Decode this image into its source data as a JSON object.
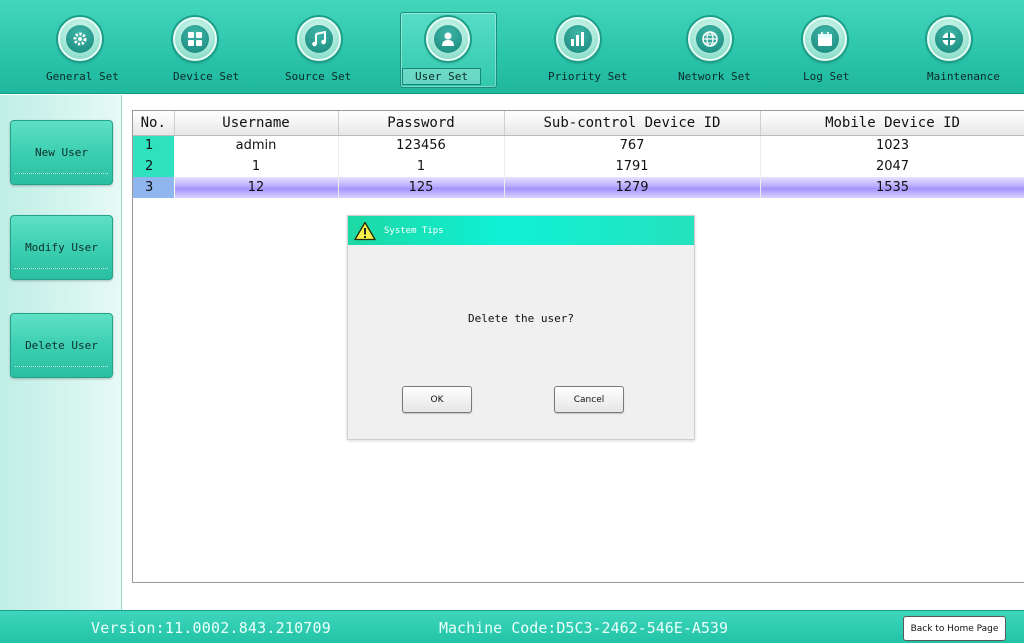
{
  "toolbar": {
    "items": [
      {
        "label": "General Set",
        "icon": "gear-icon"
      },
      {
        "label": "Device Set",
        "icon": "grid-icon"
      },
      {
        "label": "Source Set",
        "icon": "music-note-icon"
      },
      {
        "label": "User Set",
        "icon": "user-icon",
        "active": true
      },
      {
        "label": "Priority Set",
        "icon": "bar-chart-icon"
      },
      {
        "label": "Network Set",
        "icon": "globe-icon"
      },
      {
        "label": "Log Set",
        "icon": "calendar-icon"
      },
      {
        "label": "Maintenance",
        "icon": "shield-icon"
      }
    ]
  },
  "sidebar": {
    "new_user": "New User",
    "modify_user": "Modify User",
    "delete_user": "Delete User"
  },
  "table": {
    "columns": [
      "No.",
      "Username",
      "Password",
      "Sub-control Device ID",
      "Mobile Device ID"
    ],
    "rows": [
      {
        "no": "1",
        "username": "admin",
        "password": "123456",
        "sub_id": "767",
        "mobile_id": "1023"
      },
      {
        "no": "2",
        "username": "1",
        "password": "1",
        "sub_id": "1791",
        "mobile_id": "2047"
      },
      {
        "no": "3",
        "username": "12",
        "password": "125",
        "sub_id": "1279",
        "mobile_id": "1535",
        "selected": true
      }
    ]
  },
  "dialog": {
    "title": "System Tips",
    "message": "Delete the user?",
    "ok": "OK",
    "cancel": "Cancel"
  },
  "footer": {
    "version": "Version:11.0002.843.210709",
    "machine_code": "Machine Code:D5C3-2462-546E-A539",
    "back_home": "Back to Home Page"
  },
  "colors": {
    "accent": "#2cc6ac",
    "row_number": "#2fe1bf",
    "selected_row": "#a394ff",
    "dialog_title": "#0ff1d6"
  }
}
